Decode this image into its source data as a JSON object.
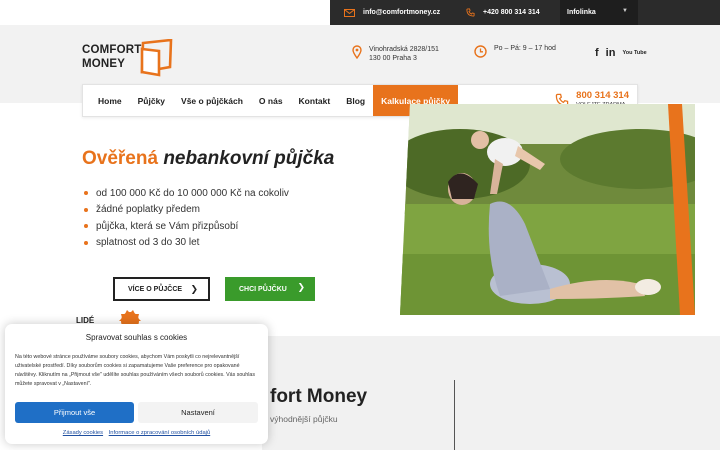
{
  "topbar": {
    "email": "info@comfortmoney.cz",
    "phone": "+420 800 314 314",
    "select_value": "Infolinka",
    "icons": [
      "mail-icon",
      "phone-icon",
      "chevron-down-icon"
    ]
  },
  "header": {
    "logo_line1": "COMFORT",
    "logo_line2": "MONEY",
    "address_line1": "Vinohradská 2828/151",
    "address_line2": "130 00 Praha 3",
    "hours": "Po – Pá: 9 – 17 hod",
    "social": [
      "f",
      "in",
      "You Tube"
    ]
  },
  "nav": {
    "items": [
      "Home",
      "Půjčky",
      "Vše o půjčkách",
      "O nás",
      "Kontakt",
      "Blog",
      "Kalkulace půjčky"
    ],
    "phone_number": "800 314 314",
    "phone_sub": "VOLEJTE ZDARMA"
  },
  "hero": {
    "title_accent": "Ověřená",
    "title_rest": "nebankovní půjčka",
    "bullets": [
      "od 100 000 Kč do 10 000 000 Kč na cokoliv",
      "žádné poplatky předem",
      "půjčka, která se Vám přizpůsobí",
      "splatnost od 3 do 30 let"
    ],
    "btn_more": "VÍCE O PŮJČCE",
    "btn_go": "CHCI PŮJČKU",
    "stamp_text": "LIDÉ"
  },
  "lower": {
    "title": "fort Money",
    "subtitle": "výhodnější půjčku"
  },
  "cookie": {
    "title": "Spravovat souhlas s cookies",
    "close": "×",
    "text": "Na této webové stránce používáme soubory cookies, abychom Vám poskytli co nejrelevantnější uživatelské prostředí. Díky souborům cookies si zapamatujeme Vaše preference pro opakované návštěvy. Kliknutím na „Přijmout vše\" udělíte souhlas používáním všech souborů cookies. Vás souhlas můžete spravovat v „Nastavení\".",
    "accept": "Přijmout vše",
    "settings": "Nastavení",
    "link1": "Zásady cookies",
    "link2": "Informace o zpracování osobních údajů"
  },
  "colors": {
    "accent": "#e8731c",
    "green": "#3a9b2b",
    "dark": "#2b2b2b",
    "blue": "#1f6fc6"
  }
}
